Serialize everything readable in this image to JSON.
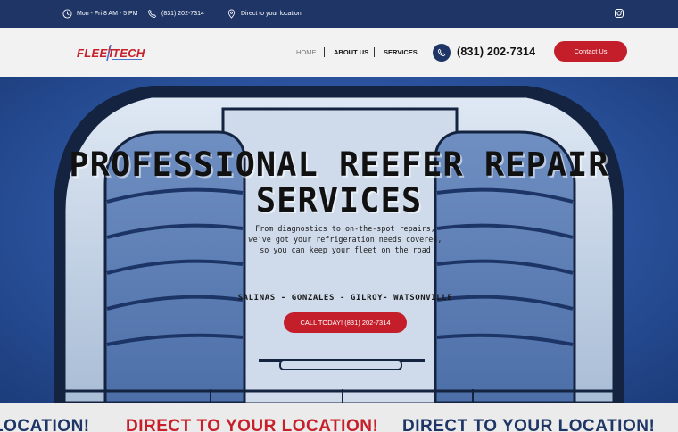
{
  "topbar": {
    "hours": "Mon - Fri 8 AM - 5 PM",
    "phone": "(831) 202-7314",
    "location": "Direct to your location",
    "social_icon": "instagram-icon"
  },
  "header": {
    "logo_word1": "FLEET",
    "logo_word2": "TECH",
    "nav": {
      "home": "HOME",
      "about": "ABOUT US",
      "services": "SERVICES"
    },
    "phone": "(831) 202-7314",
    "contact_label": "Contact Us"
  },
  "hero": {
    "title_line1": "PROFESSIONAL REEFER REPAIR",
    "title_line2": "SERVICES",
    "subtitle_line1": "From diagnostics to on-the-spot repairs,",
    "subtitle_line2": "we’ve got your refrigeration needs covered,",
    "subtitle_line3": "so you can keep your fleet on the road",
    "cities": "SALINAS - GONZALES - GILROY- WATSONVILLE",
    "cta_label": "CALL TODAY! (831) 202-7314"
  },
  "marquee": {
    "item_left": "LOCATION!",
    "item_mid": "DIRECT TO YOUR LOCATION!",
    "item_right": "DIRECT TO YOUR LOCATION!"
  },
  "colors": {
    "navy": "#1e3566",
    "red": "#c41e2b",
    "hero_blue": "#2e58a6",
    "header_bg": "#f2f2f2"
  }
}
